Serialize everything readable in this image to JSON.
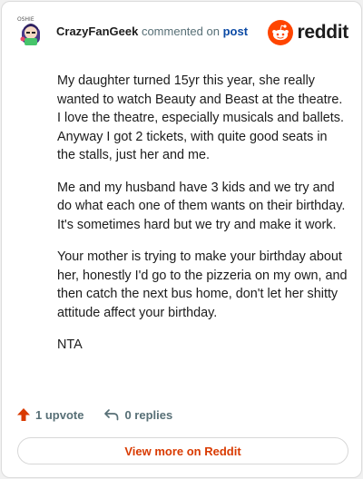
{
  "header": {
    "author": "CrazyFanGeek",
    "action_text": "commented on",
    "post_link": "post",
    "brand": "reddit",
    "avatar_caption": "OSHIE"
  },
  "comment": {
    "paragraphs": [
      "My daughter turned 15yr this year, she really wanted to watch Beauty and Beast at the theatre. I love the theatre, especially musicals and ballets. Anyway I got 2 tickets, with quite good seats in the stalls, just her and me.",
      "Me and my husband have 3 kids and we try and do what each one of them wants on their birthday. It's sometimes hard but we try and make it work.",
      "Your mother is trying to make your birthday about her, honestly I'd go to the pizzeria on my own, and then catch the next bus home, don't let her shitty attitude affect your birthday.",
      "NTA"
    ]
  },
  "actions": {
    "upvote": "1 upvote",
    "replies": "0 replies"
  },
  "footer": {
    "view_more": "View more on Reddit"
  },
  "colors": {
    "accent": "#ff4500",
    "link": "#0b4aa5",
    "cta": "#d93a00",
    "upvote": "#d93a00"
  },
  "icons": {
    "upvote": "upvote-arrow-icon",
    "reply": "reply-arrow-icon",
    "brand": "reddit-snoo-icon"
  }
}
